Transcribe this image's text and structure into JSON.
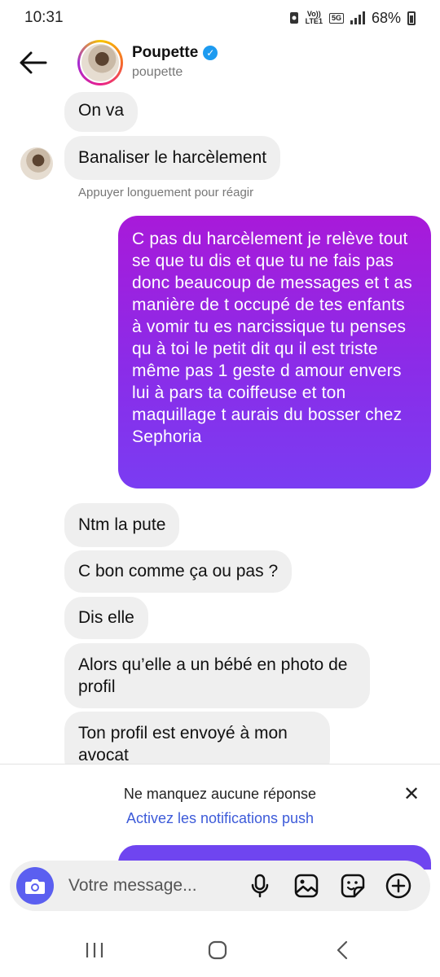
{
  "status": {
    "time": "10:31",
    "network_top": "Vo))",
    "network_bottom": "LTE1",
    "gen": "5G",
    "battery": "68%"
  },
  "header": {
    "name": "Poupette",
    "handle": "poupette"
  },
  "messages": {
    "m1": "On va",
    "m2": "Banaliser le harcèlement",
    "hint": "Appuyer longuement pour réagir",
    "m3": "C pas du harcèlement je relève tout se que tu dis et que tu ne fais pas donc beaucoup de messages et t as manière de t occupé de tes enfants à vomir tu es narcissique tu penses qu à toi le petit dit qu il est triste même pas 1 geste d amour envers lui à pars ta coiffeuse et ton maquillage t aurais du bosser chez Sephoria",
    "m4": "Ntm la pute",
    "m5": "C bon comme ça ou pas ?",
    "m6": "Dis elle",
    "m7": "Alors qu’elle a un bébé en photo de profil",
    "m8": "Ton profil est envoyé à mon avocat"
  },
  "notification": {
    "title": "Ne manquez aucune réponse",
    "link": "Activez les notifications push"
  },
  "composer": {
    "placeholder": "Votre message..."
  },
  "colors": {
    "accent": "#5b5ff0",
    "outgoing_top": "#a81ad9",
    "outgoing_bottom": "#7a3cf2",
    "incoming": "#efefef",
    "link": "#3d5bd9"
  },
  "icons": [
    "back-arrow-icon",
    "verified-icon",
    "camera-icon",
    "microphone-icon",
    "image-icon",
    "sticker-icon",
    "add-icon",
    "close-icon",
    "recents-icon",
    "home-icon",
    "nav-back-icon"
  ]
}
